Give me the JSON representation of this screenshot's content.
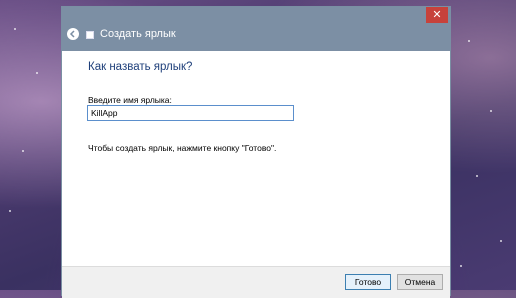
{
  "window": {
    "title": "Создать ярлык",
    "close_glyph": "✕",
    "back_glyph": "◀"
  },
  "main": {
    "heading": "Как назвать ярлык?",
    "name_label": "Введите имя ярлыка:",
    "name_value": "KillApp",
    "hint": "Чтобы создать ярлык, нажмите кнопку \"Готово\"."
  },
  "footer": {
    "finish_label": "Готово",
    "cancel_label": "Отмена"
  },
  "colors": {
    "titlebar": "#7c8fa4",
    "heading": "#1e3f7a",
    "close": "#c7423b"
  }
}
